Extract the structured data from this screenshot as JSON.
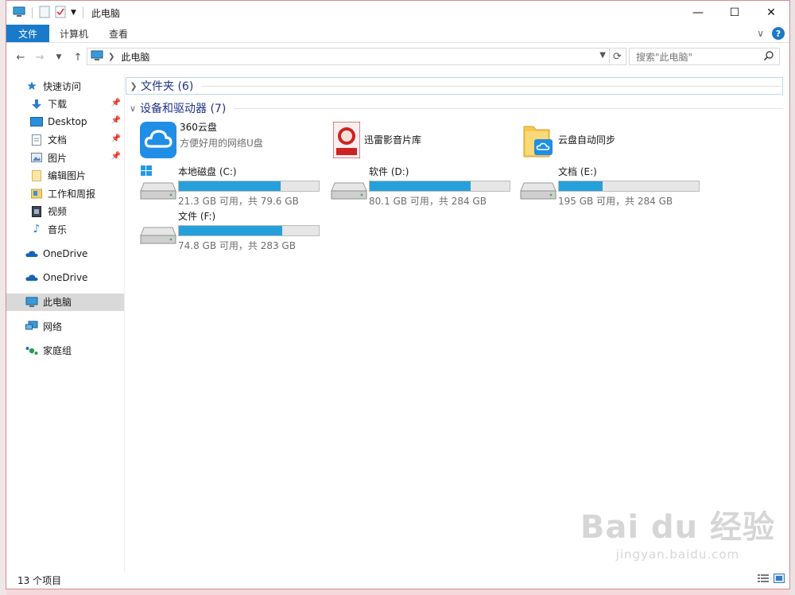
{
  "window": {
    "title": "此电脑",
    "minimize": "—",
    "maximize": "☐",
    "close": "✕"
  },
  "ribbon": {
    "tabs": [
      "文件",
      "计算机",
      "查看"
    ],
    "expand_glyph": "∨",
    "help_glyph": "?"
  },
  "address": {
    "crumb": "此电脑",
    "search_placeholder": "搜索\"此电脑\""
  },
  "sidebar": {
    "items": [
      {
        "label": "快速访问",
        "icon": "star-icon"
      },
      {
        "label": "下载",
        "icon": "download-icon",
        "pinned": true
      },
      {
        "label": "Desktop",
        "icon": "desktop-icon",
        "pinned": true
      },
      {
        "label": "文档",
        "icon": "document-icon",
        "pinned": true
      },
      {
        "label": "图片",
        "icon": "picture-icon",
        "pinned": true
      },
      {
        "label": "编辑图片",
        "icon": "folder-icon"
      },
      {
        "label": "工作和周报",
        "icon": "folder-icon"
      },
      {
        "label": "视频",
        "icon": "video-icon"
      },
      {
        "label": "音乐",
        "icon": "music-icon"
      },
      {
        "label": "OneDrive",
        "icon": "onedrive-icon"
      },
      {
        "label": "OneDrive",
        "icon": "onedrive-icon"
      },
      {
        "label": "此电脑",
        "icon": "computer-icon",
        "selected": true
      },
      {
        "label": "网络",
        "icon": "network-icon"
      },
      {
        "label": "家庭组",
        "icon": "homegroup-icon"
      }
    ]
  },
  "groups": {
    "folders": "文件夹 (6)",
    "devices": "设备和驱动器 (7)"
  },
  "apps": [
    {
      "name": "360云盘",
      "sub": "方便好用的网络U盘",
      "icon": "360-cloud-icon"
    },
    {
      "name": "迅雷影音片库",
      "sub": "",
      "icon": "xunlei-library-icon"
    },
    {
      "name": "云盘自动同步",
      "sub": "",
      "icon": "cloud-sync-folder-icon"
    }
  ],
  "drives": [
    {
      "name": "本地磁盘 (C:)",
      "free": "21.3 GB 可用，共 79.6 GB",
      "used_fraction": 0.73,
      "icon": "windows-drive-icon"
    },
    {
      "name": "软件 (D:)",
      "free": "80.1 GB 可用，共 284 GB",
      "used_fraction": 0.72,
      "icon": "drive-icon"
    },
    {
      "name": "文档 (E:)",
      "free": "195 GB 可用，共 284 GB",
      "used_fraction": 0.31,
      "icon": "drive-icon"
    },
    {
      "name": "文件 (F:)",
      "free": "74.8 GB 可用，共 283 GB",
      "used_fraction": 0.74,
      "icon": "drive-icon"
    }
  ],
  "status": {
    "count": "13 个项目"
  },
  "watermark": {
    "line1": "Bai du 经验",
    "line2": "jingyan.baidu.com"
  }
}
